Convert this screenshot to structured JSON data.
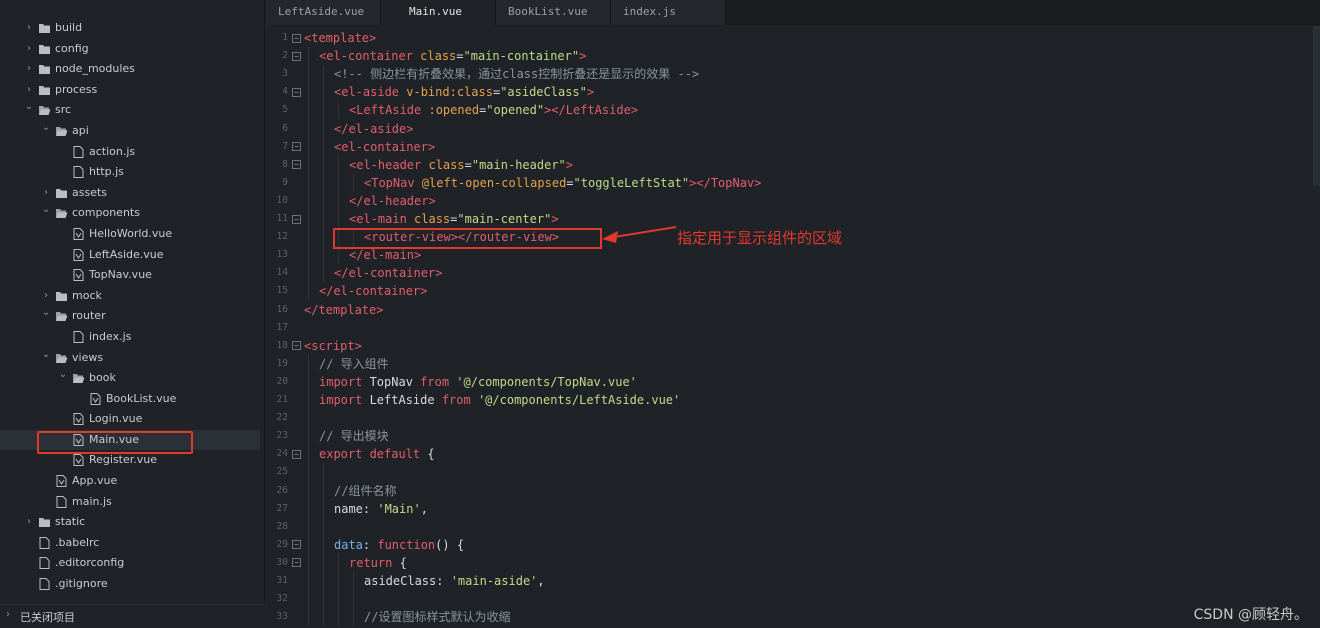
{
  "sidebar": {
    "tree": [
      {
        "label": "build",
        "type": "folder",
        "depth": 0,
        "state": "collapsed"
      },
      {
        "label": "config",
        "type": "folder",
        "depth": 0,
        "state": "collapsed"
      },
      {
        "label": "node_modules",
        "type": "folder",
        "depth": 0,
        "state": "collapsed"
      },
      {
        "label": "process",
        "type": "folder",
        "depth": 0,
        "state": "collapsed"
      },
      {
        "label": "src",
        "type": "folder",
        "depth": 0,
        "state": "expanded"
      },
      {
        "label": "api",
        "type": "folder",
        "depth": 1,
        "state": "expanded"
      },
      {
        "label": "action.js",
        "type": "file",
        "depth": 2
      },
      {
        "label": "http.js",
        "type": "file",
        "depth": 2
      },
      {
        "label": "assets",
        "type": "folder",
        "depth": 1,
        "state": "collapsed"
      },
      {
        "label": "components",
        "type": "folder",
        "depth": 1,
        "state": "expanded"
      },
      {
        "label": "HelloWorld.vue",
        "type": "file",
        "depth": 2
      },
      {
        "label": "LeftAside.vue",
        "type": "file",
        "depth": 2
      },
      {
        "label": "TopNav.vue",
        "type": "file",
        "depth": 2
      },
      {
        "label": "mock",
        "type": "folder",
        "depth": 1,
        "state": "collapsed"
      },
      {
        "label": "router",
        "type": "folder",
        "depth": 1,
        "state": "expanded"
      },
      {
        "label": "index.js",
        "type": "file",
        "depth": 2
      },
      {
        "label": "views",
        "type": "folder",
        "depth": 1,
        "state": "expanded"
      },
      {
        "label": "book",
        "type": "folder",
        "depth": 2,
        "state": "expanded"
      },
      {
        "label": "BookList.vue",
        "type": "file",
        "depth": 3
      },
      {
        "label": "Login.vue",
        "type": "file",
        "depth": 2
      },
      {
        "label": "Main.vue",
        "type": "file",
        "depth": 2,
        "active": true
      },
      {
        "label": "Register.vue",
        "type": "file",
        "depth": 2
      },
      {
        "label": "App.vue",
        "type": "file",
        "depth": 1
      },
      {
        "label": "main.js",
        "type": "file",
        "depth": 1
      },
      {
        "label": "static",
        "type": "folder",
        "depth": 0,
        "state": "collapsed"
      },
      {
        "label": ".babelrc",
        "type": "file",
        "depth": 0
      },
      {
        "label": ".editorconfig",
        "type": "file",
        "depth": 0
      },
      {
        "label": ".gitignore",
        "type": "file",
        "depth": 0
      }
    ],
    "footer_label": "已关闭项目"
  },
  "tabs": [
    {
      "label": "LeftAside.vue",
      "active": false
    },
    {
      "label": "Main.vue",
      "active": true
    },
    {
      "label": "BookList.vue",
      "active": false
    },
    {
      "label": "index.js",
      "active": false
    }
  ],
  "editor": {
    "lines": [
      {
        "n": "1",
        "fold": true,
        "indent": 0,
        "tokens": [
          [
            "tag",
            "<template>"
          ]
        ]
      },
      {
        "n": "2",
        "fold": true,
        "indent": 1,
        "tokens": [
          [
            "tag",
            "<el-container "
          ],
          [
            "attr",
            "class"
          ],
          [
            "plain",
            "="
          ],
          [
            "str",
            "\"main-container\""
          ],
          [
            "tag",
            ">"
          ]
        ]
      },
      {
        "n": "3",
        "fold": false,
        "indent": 2,
        "tokens": [
          [
            "cmt",
            "<!-- 侧边栏有折叠效果，通过class控制折叠还是显示的效果 -->"
          ]
        ]
      },
      {
        "n": "4",
        "fold": true,
        "indent": 2,
        "tokens": [
          [
            "tag",
            "<el-aside "
          ],
          [
            "attr",
            "v-bind:class"
          ],
          [
            "plain",
            "="
          ],
          [
            "str",
            "\"asideClass\""
          ],
          [
            "tag",
            ">"
          ]
        ]
      },
      {
        "n": "5",
        "fold": false,
        "indent": 3,
        "tokens": [
          [
            "tag",
            "<LeftAside "
          ],
          [
            "attr",
            ":opened"
          ],
          [
            "plain",
            "="
          ],
          [
            "str",
            "\"opened\""
          ],
          [
            "tag",
            "></"
          ],
          [
            "tag",
            "LeftAside"
          ],
          [
            "tag",
            ">"
          ]
        ]
      },
      {
        "n": "6",
        "fold": false,
        "indent": 2,
        "tokens": [
          [
            "tag",
            "</el-aside>"
          ]
        ]
      },
      {
        "n": "7",
        "fold": true,
        "indent": 2,
        "tokens": [
          [
            "tag",
            "<el-container>"
          ]
        ]
      },
      {
        "n": "8",
        "fold": true,
        "indent": 3,
        "tokens": [
          [
            "tag",
            "<el-header "
          ],
          [
            "attr",
            "class"
          ],
          [
            "plain",
            "="
          ],
          [
            "str",
            "\"main-header\""
          ],
          [
            "tag",
            ">"
          ]
        ]
      },
      {
        "n": "9",
        "fold": false,
        "indent": 4,
        "tokens": [
          [
            "tag",
            "<TopNav "
          ],
          [
            "attr",
            "@left-open-collapsed"
          ],
          [
            "plain",
            "="
          ],
          [
            "str",
            "\"toggleLeftStat\""
          ],
          [
            "tag",
            "></"
          ],
          [
            "tag",
            "TopNav"
          ],
          [
            "tag",
            ">"
          ]
        ]
      },
      {
        "n": "10",
        "fold": false,
        "indent": 3,
        "tokens": [
          [
            "tag",
            "</el-header>"
          ]
        ]
      },
      {
        "n": "11",
        "fold": true,
        "indent": 3,
        "tokens": [
          [
            "tag",
            "<el-main "
          ],
          [
            "attr",
            "class"
          ],
          [
            "plain",
            "="
          ],
          [
            "str",
            "\"main-center\""
          ],
          [
            "tag",
            ">"
          ]
        ]
      },
      {
        "n": "12",
        "fold": false,
        "indent": 4,
        "tokens": [
          [
            "tag",
            "<router-view></router-view>"
          ]
        ]
      },
      {
        "n": "13",
        "fold": false,
        "indent": 3,
        "tokens": [
          [
            "tag",
            "</el-main>"
          ]
        ]
      },
      {
        "n": "14",
        "fold": false,
        "indent": 2,
        "tokens": [
          [
            "tag",
            "</el-container>"
          ]
        ]
      },
      {
        "n": "15",
        "fold": false,
        "indent": 1,
        "tokens": [
          [
            "tag",
            "</el-container>"
          ]
        ]
      },
      {
        "n": "16",
        "fold": false,
        "indent": 0,
        "tokens": [
          [
            "tag",
            "</template>"
          ]
        ]
      },
      {
        "n": "17",
        "fold": false,
        "indent": 0,
        "tokens": []
      },
      {
        "n": "18",
        "fold": true,
        "indent": 0,
        "tokens": [
          [
            "tag",
            "<script>"
          ]
        ]
      },
      {
        "n": "19",
        "fold": false,
        "indent": 1,
        "tokens": [
          [
            "cmt",
            "// 导入组件"
          ]
        ]
      },
      {
        "n": "20",
        "fold": false,
        "indent": 1,
        "tokens": [
          [
            "kw",
            "import "
          ],
          [
            "plain",
            "TopNav "
          ],
          [
            "kw",
            "from "
          ],
          [
            "str",
            "'@/components/TopNav.vue'"
          ]
        ]
      },
      {
        "n": "21",
        "fold": false,
        "indent": 1,
        "tokens": [
          [
            "kw",
            "import "
          ],
          [
            "plain",
            "LeftAside "
          ],
          [
            "kw",
            "from "
          ],
          [
            "str",
            "'@/components/LeftAside.vue'"
          ]
        ]
      },
      {
        "n": "22",
        "fold": false,
        "indent": 0,
        "tokens": []
      },
      {
        "n": "23",
        "fold": false,
        "indent": 1,
        "tokens": [
          [
            "cmt",
            "// 导出模块"
          ]
        ]
      },
      {
        "n": "24",
        "fold": true,
        "indent": 1,
        "tokens": [
          [
            "kw",
            "export "
          ],
          [
            "kw",
            "default "
          ],
          [
            "plain",
            "{"
          ]
        ]
      },
      {
        "n": "25",
        "fold": false,
        "indent": 0,
        "tokens": []
      },
      {
        "n": "26",
        "fold": false,
        "indent": 2,
        "tokens": [
          [
            "cmt",
            "//组件名称"
          ]
        ]
      },
      {
        "n": "27",
        "fold": false,
        "indent": 2,
        "tokens": [
          [
            "plain",
            "name: "
          ],
          [
            "str",
            "'Main'"
          ],
          [
            "plain",
            ","
          ]
        ]
      },
      {
        "n": "28",
        "fold": false,
        "indent": 0,
        "tokens": []
      },
      {
        "n": "29",
        "fold": true,
        "indent": 2,
        "tokens": [
          [
            "fn",
            "data"
          ],
          [
            "plain",
            ": "
          ],
          [
            "kw",
            "function"
          ],
          [
            "plain",
            "() {"
          ]
        ]
      },
      {
        "n": "30",
        "fold": true,
        "indent": 3,
        "tokens": [
          [
            "kw",
            "return "
          ],
          [
            "plain",
            "{"
          ]
        ]
      },
      {
        "n": "31",
        "fold": false,
        "indent": 4,
        "tokens": [
          [
            "plain",
            "asideClass: "
          ],
          [
            "str",
            "'main-aside'"
          ],
          [
            "plain",
            ","
          ]
        ]
      },
      {
        "n": "32",
        "fold": false,
        "indent": 0,
        "tokens": []
      },
      {
        "n": "33",
        "fold": false,
        "indent": 4,
        "tokens": [
          [
            "cmt",
            "//设置图标样式默认为收缩"
          ]
        ]
      }
    ]
  },
  "annotation": {
    "text": "指定用于显示组件的区域",
    "color": "#e0392e"
  },
  "watermark": "CSDN @顾轻舟。",
  "colors": {
    "background": "#1f2327",
    "tag": "#e35d6a",
    "attr": "#e5a04a",
    "string": "#c3d888",
    "comment": "#8c939a",
    "highlight": "#e0392e"
  }
}
